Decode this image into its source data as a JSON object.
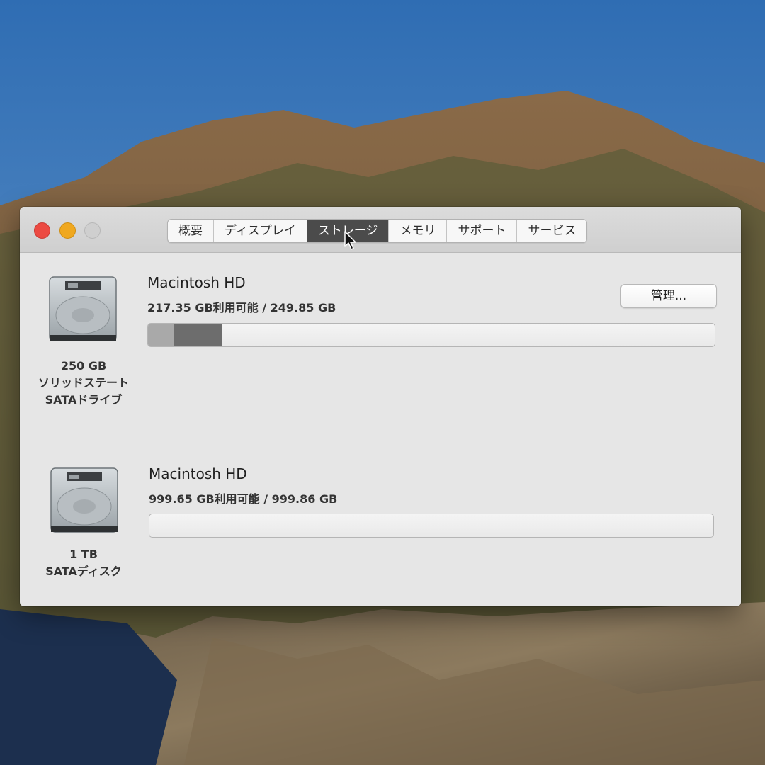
{
  "window": {
    "tabs": [
      {
        "label": "概要",
        "active": false
      },
      {
        "label": "ディスプレイ",
        "active": false
      },
      {
        "label": "ストレージ",
        "active": true
      },
      {
        "label": "メモリ",
        "active": false
      },
      {
        "label": "サポート",
        "active": false
      },
      {
        "label": "サービス",
        "active": false
      }
    ]
  },
  "drives": [
    {
      "capacity": "250 GB",
      "type_line1": "ソリッドステート",
      "type_line2": "SATAドライブ",
      "volume_name": "Macintosh HD",
      "space_text": "217.35 GB利用可能 / 249.85 GB",
      "manage_label": "管理...",
      "usage": [
        {
          "category": "system",
          "fraction": 0.045,
          "color": "#a9a9a9"
        },
        {
          "category": "other",
          "fraction": 0.085,
          "color": "#6d6d6d"
        }
      ]
    },
    {
      "capacity": "1 TB",
      "type_line1": "SATAディスク",
      "volume_name": "Macintosh HD",
      "space_text": "999.65 GB利用可能 / 999.86 GB",
      "usage": []
    }
  ]
}
